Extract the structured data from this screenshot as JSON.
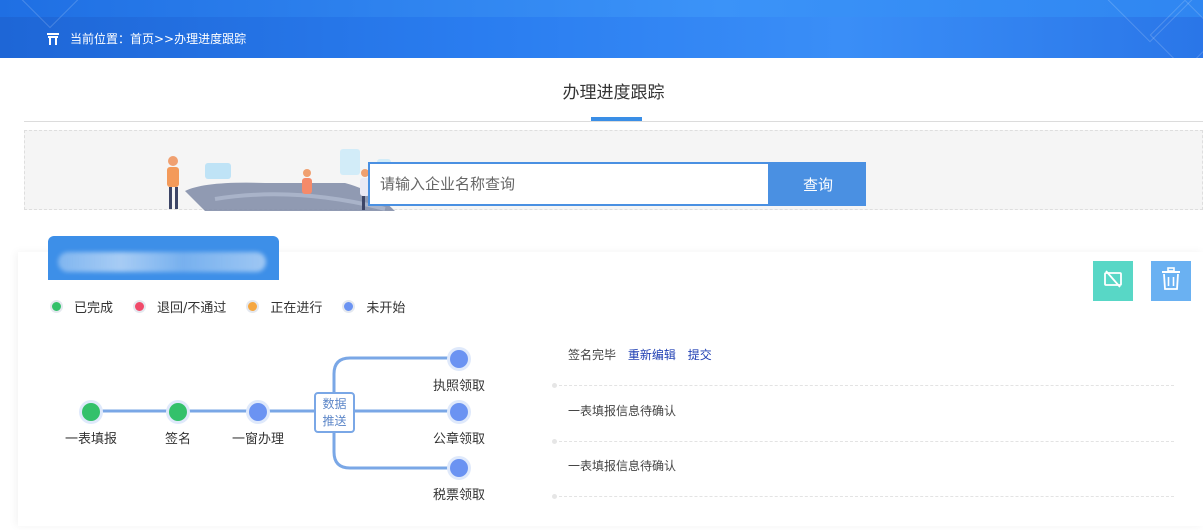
{
  "colors": {
    "primary": "#4a90e2",
    "completed": "#33c16b",
    "rejected": "#f04a6a",
    "in_progress": "#f5a742",
    "not_started": "#6b93f2",
    "teal_button": "#58d7c6"
  },
  "breadcrumb": {
    "icon": "home-icon",
    "text": "当前位置：首页>>办理进度跟踪"
  },
  "page_title": "办理进度跟踪",
  "search": {
    "placeholder": "请输入企业名称查询",
    "button_label": "查询"
  },
  "card": {
    "company_name": "",
    "actions": [
      {
        "name": "unlink",
        "icon": "unlink-icon"
      },
      {
        "name": "delete",
        "icon": "trash-icon"
      }
    ]
  },
  "legend": [
    {
      "label": "已完成",
      "status": "completed"
    },
    {
      "label": "退回/不通过",
      "status": "rejected"
    },
    {
      "label": "正在进行",
      "status": "in_progress"
    },
    {
      "label": "未开始",
      "status": "not_started"
    }
  ],
  "flow": {
    "steps": [
      {
        "label": "一表填报",
        "status": "completed"
      },
      {
        "label": "签名",
        "status": "completed"
      },
      {
        "label": "一窗办理",
        "status": "not_started"
      }
    ],
    "push_label_line1": "数据",
    "push_label_line2": "推送",
    "branches": [
      {
        "label": "执照领取",
        "status": "not_started"
      },
      {
        "label": "公章领取",
        "status": "not_started"
      },
      {
        "label": "税票领取",
        "status": "not_started"
      }
    ]
  },
  "rows": [
    {
      "text": "签名完毕",
      "links": [
        "重新编辑",
        "提交"
      ]
    },
    {
      "text": "一表填报信息待确认",
      "links": []
    },
    {
      "text": "一表填报信息待确认",
      "links": []
    }
  ]
}
